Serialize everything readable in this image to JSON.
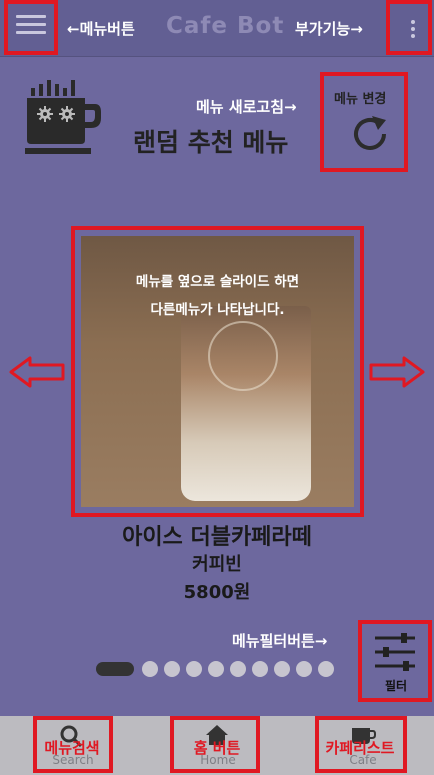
{
  "colors": {
    "highlight": "#e01822",
    "background": "#6d689e",
    "topbar": "#625f93",
    "bottombar": "#bcbbc0"
  },
  "header": {
    "menu_button_icon": "hamburger-icon",
    "menu_button_annotation": "←메뉴버튼",
    "app_title": "Cafe Bot",
    "extra_annotation": "부가기능→",
    "more_icon": "kebab-icon"
  },
  "recommend": {
    "refresh_annotation": "메뉴 새로고침→",
    "title": "랜덤 추천 메뉴",
    "refresh_button_label": "메뉴 변경",
    "refresh_icon": "refresh-icon"
  },
  "carousel": {
    "hint_line1": "메뉴를 옆으로 슬라이드 하면",
    "hint_line2": "다른메뉴가 나타납니다.",
    "prev_icon": "arrow-left-icon",
    "next_icon": "arrow-right-icon",
    "page_count": 10,
    "active_index": 0
  },
  "menu_item": {
    "name": "아이스 더블카페라떼",
    "brand": "커피빈",
    "price": "5800원"
  },
  "filter": {
    "annotation": "메뉴필터버튼→",
    "label": "필터",
    "icon": "sliders-icon"
  },
  "bottom_nav": {
    "search": {
      "annotation": "메뉴검색",
      "label": "Search",
      "icon": "search-icon"
    },
    "home": {
      "annotation": "홈 버튼",
      "label": "Home",
      "icon": "home-icon"
    },
    "cafe": {
      "annotation": "카페리스트",
      "label": "Cafe",
      "icon": "cup-icon"
    }
  }
}
